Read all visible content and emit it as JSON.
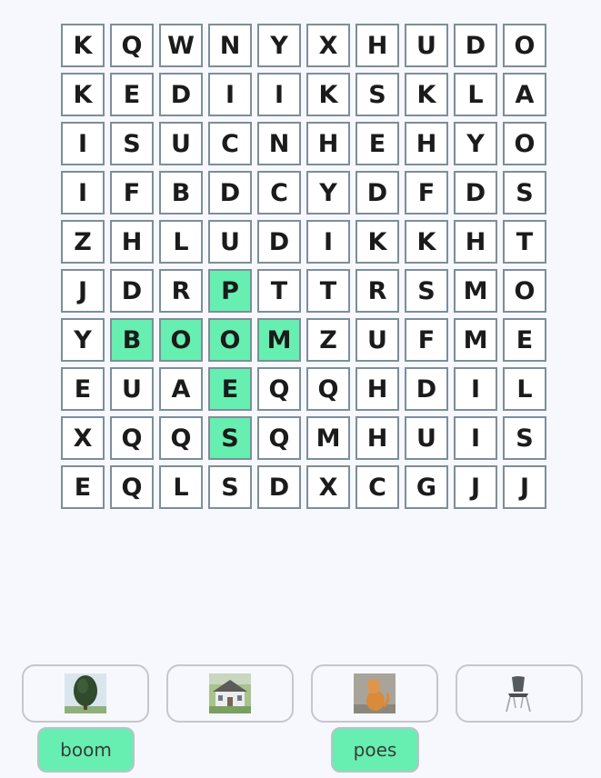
{
  "grid": {
    "rows": [
      [
        "K",
        "Q",
        "W",
        "N",
        "Y",
        "X",
        "H",
        "U",
        "D",
        "O"
      ],
      [
        "K",
        "E",
        "D",
        "I",
        "I",
        "K",
        "S",
        "K",
        "L",
        "A"
      ],
      [
        "I",
        "S",
        "U",
        "C",
        "N",
        "H",
        "E",
        "H",
        "Y",
        "O"
      ],
      [
        "I",
        "F",
        "B",
        "D",
        "C",
        "Y",
        "D",
        "F",
        "D",
        "S"
      ],
      [
        "Z",
        "H",
        "L",
        "U",
        "D",
        "I",
        "K",
        "K",
        "H",
        "T"
      ],
      [
        "J",
        "D",
        "R",
        "P",
        "T",
        "T",
        "R",
        "S",
        "M",
        "O"
      ],
      [
        "Y",
        "B",
        "O",
        "O",
        "M",
        "Z",
        "U",
        "F",
        "M",
        "E"
      ],
      [
        "E",
        "U",
        "A",
        "E",
        "Q",
        "Q",
        "H",
        "D",
        "I",
        "L"
      ],
      [
        "X",
        "Q",
        "Q",
        "S",
        "Q",
        "M",
        "H",
        "U",
        "I",
        "S"
      ],
      [
        "E",
        "Q",
        "L",
        "S",
        "D",
        "X",
        "C",
        "G",
        "J",
        "J"
      ]
    ],
    "found": [
      [
        5,
        3
      ],
      [
        6,
        1
      ],
      [
        6,
        2
      ],
      [
        6,
        3
      ],
      [
        6,
        4
      ],
      [
        7,
        3
      ],
      [
        8,
        3
      ]
    ]
  },
  "cards": [
    {
      "icon": "tree-image",
      "found_word": "boom"
    },
    {
      "icon": "house-image",
      "found_word": ""
    },
    {
      "icon": "cat-image",
      "found_word": "poes"
    },
    {
      "icon": "chair-image",
      "found_word": ""
    }
  ],
  "colors": {
    "highlight": "#66efb0",
    "cell_border": "#7d8e98",
    "background": "#f7f8fd"
  }
}
